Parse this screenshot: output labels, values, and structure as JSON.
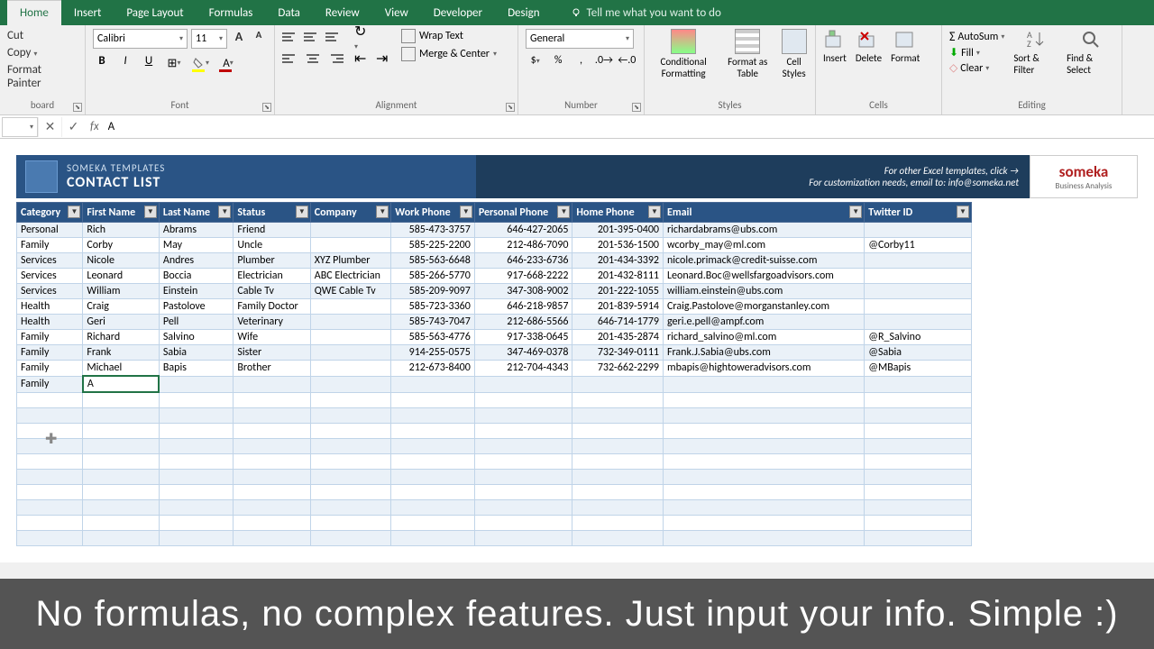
{
  "tabs": [
    "Home",
    "Insert",
    "Page Layout",
    "Formulas",
    "Data",
    "Review",
    "View",
    "Developer",
    "Design"
  ],
  "tell_me": "Tell me what you want to do",
  "clipboard": {
    "cut": "Cut",
    "copy": "Copy",
    "paint": "Format Painter",
    "label": "board"
  },
  "font": {
    "name": "Calibri",
    "size": "11",
    "label": "Font"
  },
  "alignment": {
    "wrap": "Wrap Text",
    "merge": "Merge & Center",
    "label": "Alignment"
  },
  "number": {
    "format": "General",
    "label": "Number"
  },
  "styles": {
    "cond": "Conditional Formatting",
    "table": "Format as Table",
    "cell": "Cell Styles",
    "label": "Styles"
  },
  "cells": {
    "insert": "Insert",
    "delete": "Delete",
    "format": "Format",
    "label": "Cells"
  },
  "editing": {
    "autosum": "AutoSum",
    "fill": "Fill",
    "clear": "Clear",
    "sort": "Sort & Filter",
    "find": "Find & Select",
    "label": "Editing"
  },
  "formula_value": "A",
  "banner": {
    "sub": "SOMEKA TEMPLATES",
    "title": "CONTACT LIST",
    "link": "For other Excel templates, click →",
    "email": "For customization needs, email to: info@someka.net",
    "logo": "someka",
    "logosub": "Business Analysis"
  },
  "headers": [
    "Category",
    "First Name",
    "Last Name",
    "Status",
    "Company",
    "Work Phone",
    "Personal Phone",
    "Home Phone",
    "Email",
    "Twitter ID"
  ],
  "rows": [
    [
      "Personal",
      "Rich",
      "Abrams",
      "Friend",
      "",
      "585-473-3757",
      "646-427-2065",
      "201-395-0400",
      "richardabrams@ubs.com",
      ""
    ],
    [
      "Family",
      "Corby",
      "May",
      "Uncle",
      "",
      "585-225-2200",
      "212-486-7090",
      "201-536-1500",
      "wcorby_may@ml.com",
      "@Corby11"
    ],
    [
      "Services",
      "Nicole",
      "Andres",
      "Plumber",
      "XYZ Plumber",
      "585-563-6648",
      "646-233-6736",
      "201-434-3392",
      "nicole.primack@credit-suisse.com",
      ""
    ],
    [
      "Services",
      "Leonard",
      "Boccia",
      "Electrician",
      "ABC Electrician",
      "585-266-5770",
      "917-668-2222",
      "201-432-8111",
      "Leonard.Boc@wellsfargoadvisors.com",
      ""
    ],
    [
      "Services",
      "William",
      "Einstein",
      "Cable Tv",
      "QWE Cable Tv",
      "585-209-9097",
      "347-308-9002",
      "201-222-1055",
      "william.einstein@ubs.com",
      ""
    ],
    [
      "Health",
      "Craig",
      "Pastolove",
      "Family Doctor",
      "",
      "585-723-3360",
      "646-218-9857",
      "201-839-5914",
      "Craig.Pastolove@morganstanley.com",
      ""
    ],
    [
      "Health",
      "Geri",
      "Pell",
      "Veterinary",
      "",
      "585-743-7047",
      "212-686-5566",
      "646-714-1779",
      "geri.e.pell@ampf.com",
      ""
    ],
    [
      "Family",
      "Richard",
      "Salvino",
      "Wife",
      "",
      "585-563-4776",
      "917-338-0645",
      "201-435-2874",
      "richard_salvino@ml.com",
      "@R_Salvino"
    ],
    [
      "Family",
      "Frank",
      "Sabia",
      "Sister",
      "",
      "914-255-0575",
      "347-469-0378",
      "732-349-0111",
      "Frank.J.Sabia@ubs.com",
      "@Sabia"
    ],
    [
      "Family",
      "Michael",
      "Bapis",
      "Brother",
      "",
      "212-673-8400",
      "212-704-4343",
      "732-662-2299",
      "mbapis@hightoweradvisors.com",
      "@MBapis"
    ]
  ],
  "editing_row": [
    "Family",
    "A",
    "",
    "",
    "",
    "",
    "",
    "",
    "",
    ""
  ],
  "caption": "No formulas, no complex features. Just input your info. Simple :)"
}
